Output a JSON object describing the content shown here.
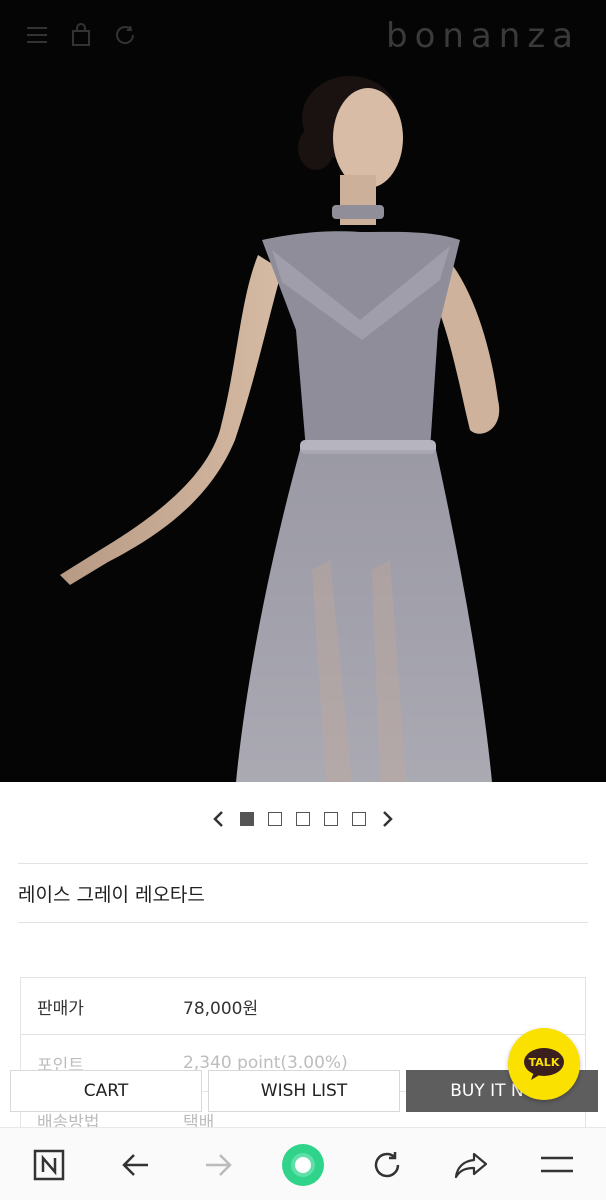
{
  "header": {
    "brand": "bonanza",
    "icons": [
      "menu-icon",
      "bag-icon",
      "refresh-icon"
    ]
  },
  "gallery": {
    "total": 5,
    "current": 1
  },
  "product": {
    "name": "레이스 그레이 레오타드"
  },
  "info_rows": [
    {
      "label": "판매가",
      "value": "78,000원"
    },
    {
      "label": "포인트",
      "value": "2,340 point(3.00%)"
    },
    {
      "label": "배송방법",
      "value": "택배"
    }
  ],
  "actions": {
    "cart": "CART",
    "wish": "WISH LIST",
    "buy": "BUY IT NOW"
  },
  "talk": {
    "label": "TALK"
  },
  "browser_bar": {
    "icons": [
      "naver-icon",
      "back-arrow-icon",
      "forward-arrow-icon",
      "home-circle-icon",
      "reload-icon",
      "share-icon",
      "menu-icon"
    ]
  },
  "colors": {
    "talk": "#fae100",
    "buy_button": "#5e5e5e",
    "home_circle": "#2fd38a"
  }
}
